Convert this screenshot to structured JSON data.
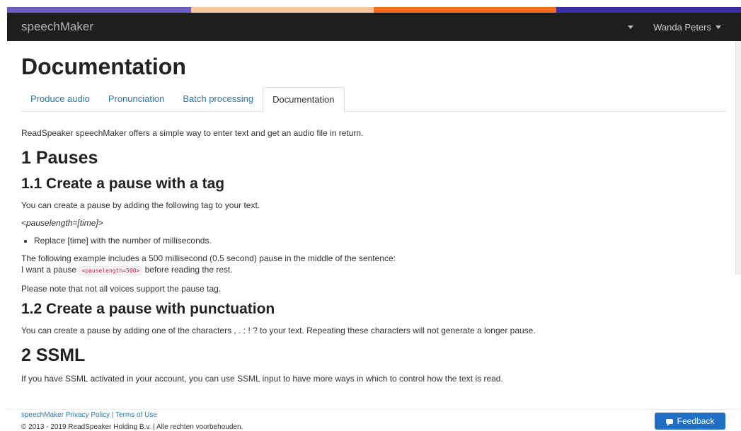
{
  "colors": {
    "stripe": [
      "#6b5ec2",
      "#f8c7a1",
      "#f36b1d",
      "#3a2fa6"
    ],
    "navbar_bg": "#1e1e1e",
    "link": "#2a7ab0",
    "feedback_bg": "#1f6fc5"
  },
  "navbar": {
    "brand": "speechMaker",
    "user": "Wanda Peters"
  },
  "page": {
    "title": "Documentation",
    "tabs": [
      {
        "label": "Produce audio"
      },
      {
        "label": "Pronunciation"
      },
      {
        "label": "Batch processing"
      },
      {
        "label": "Documentation",
        "active": true
      }
    ]
  },
  "doc": {
    "intro": "ReadSpeaker speechMaker offers a simple way to enter text and get an audio file in return.",
    "s1": "1 Pauses",
    "s1_1": "1.1 Create a pause with a tag",
    "s1_1_p1": "You can create a pause by adding the following tag to your text.",
    "s1_1_tag": "<pauselength=[time]>",
    "s1_1_bullet": "Replace [time] with the number of milliseconds.",
    "s1_1_p2": "The following example includes a 500 millisecond (0.5 second) pause in the middle of the sentence:",
    "s1_1_ex_pre": "I want a pause ",
    "s1_1_ex_code": "<pauselength=500>",
    "s1_1_ex_post": " before reading the rest.",
    "s1_1_note": "Please note that not all voices support the pause tag.",
    "s1_2": "1.2 Create a pause with punctuation",
    "s1_2_p": "You can create a pause by adding one of the characters , . : ! ? to your text. Repeating these characters will not generate a longer pause.",
    "s2": "2 SSML",
    "s2_p": "If you have SSML activated in your account, you can use SSML input to have more ways in which to control how the text is read."
  },
  "footer": {
    "privacy": "speechMaker Privacy Policy",
    "separator": " | ",
    "terms": "Terms of Use",
    "copyright": "© 2013 - 2019 ReadSpeaker Holding B.v. | Alle rechten voorbehouden.",
    "feedback": "Feedback"
  }
}
